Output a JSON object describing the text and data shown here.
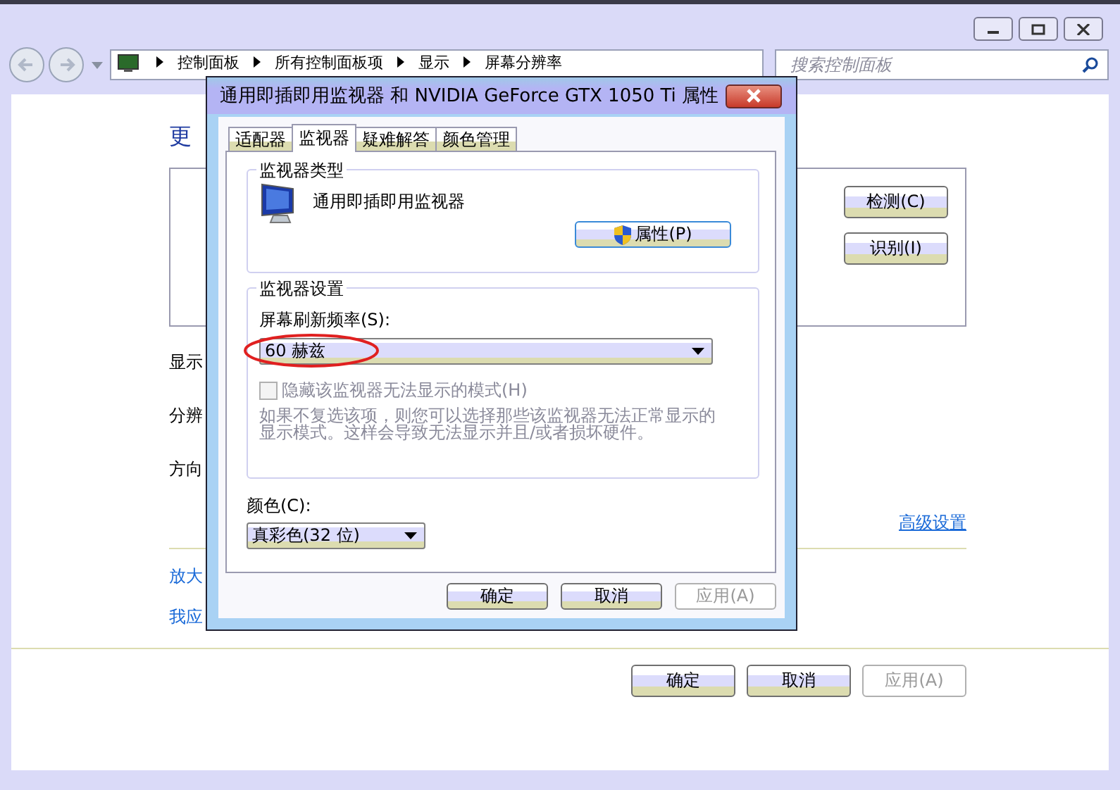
{
  "navigation": {
    "breadcrumb": [
      "控制面板",
      "所有控制面板项",
      "显示",
      "屏幕分辨率"
    ],
    "search": {
      "placeholder": "搜索控制面板"
    }
  },
  "page": {
    "heading": "更",
    "monitor_buttons": [
      "检测(C)",
      "识别(I)"
    ],
    "settings": [
      {
        "label": "显示"
      },
      {
        "label": "分辨"
      },
      {
        "label": "方向"
      }
    ],
    "advanced_link": "高级设置",
    "links": [
      "放大",
      "我应"
    ],
    "buttons": [
      {
        "label": "确定",
        "disabled": false
      },
      {
        "label": "取消",
        "disabled": false
      },
      {
        "label": "应用(A)",
        "disabled": true
      }
    ]
  },
  "dialog": {
    "title": "通用即插即用监视器 和 NVIDIA GeForce GTX 1050 Ti 属性",
    "tabs": [
      {
        "label": "适配器",
        "selected": false
      },
      {
        "label": "监视器",
        "selected": true
      },
      {
        "label": "疑难解答",
        "selected": false
      },
      {
        "label": "颜色管理",
        "selected": false
      }
    ],
    "monitor_type": {
      "legend": "监视器类型",
      "name": "通用即插即用监视器",
      "properties_button": "属性(P)"
    },
    "monitor_settings": {
      "legend": "监视器设置",
      "refresh_label": "屏幕刷新频率(S):",
      "refresh_value": "60 赫兹",
      "highlighted": true,
      "hide_modes": {
        "label": "隐藏该监视器无法显示的模式(H)",
        "checked": false,
        "disabled": true
      },
      "note": "如果不复选该项，则您可以选择那些该监视器无法正常显示的显示模式。这样会导致无法显示并且/或者损坏硬件。"
    },
    "color": {
      "label": "颜色(C):",
      "value": "真彩色(32 位)"
    },
    "buttons": [
      {
        "label": "确定",
        "disabled": false
      },
      {
        "label": "取消",
        "disabled": false
      },
      {
        "label": "应用(A)",
        "disabled": true
      }
    ]
  }
}
